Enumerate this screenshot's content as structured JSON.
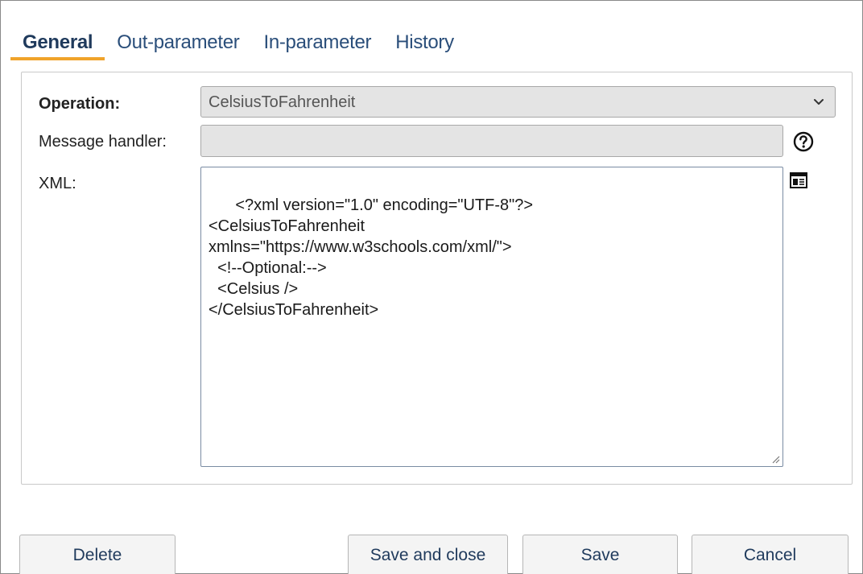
{
  "tabs": [
    {
      "label": "General",
      "active": true
    },
    {
      "label": "Out-parameter",
      "active": false
    },
    {
      "label": "In-parameter",
      "active": false
    },
    {
      "label": "History",
      "active": false
    }
  ],
  "form": {
    "operation_label": "Operation:",
    "operation_value": "CelsiusToFahrenheit",
    "message_handler_label": "Message handler:",
    "message_handler_value": "",
    "xml_label": "XML:",
    "xml_value": "<?xml version=\"1.0\" encoding=\"UTF-8\"?>\n<CelsiusToFahrenheit\nxmlns=\"https://www.w3schools.com/xml/\">\n  <!--Optional:-->\n  <Celsius />\n</CelsiusToFahrenheit>"
  },
  "icons": {
    "help": "help-circle-icon",
    "document": "document-icon",
    "dropdown": "chevron-down-icon"
  },
  "buttons": {
    "delete": "Delete",
    "save_and_close": "Save and close",
    "save": "Save",
    "cancel": "Cancel"
  },
  "colors": {
    "tab_accent": "#f0a32a",
    "tab_text": "#2a4e7a",
    "button_text": "#1f3a5c"
  }
}
